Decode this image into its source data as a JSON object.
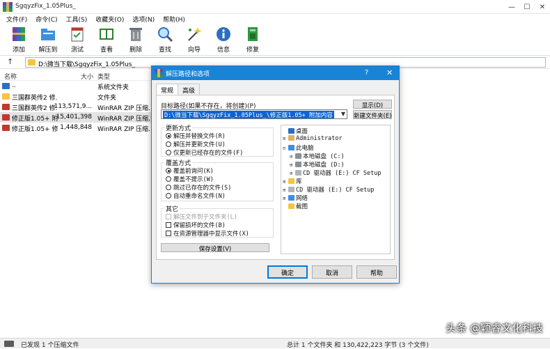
{
  "window": {
    "title": "SgqyzFix_1.05Plus_",
    "controls": [
      "—",
      "☐",
      "✕"
    ]
  },
  "menu": [
    "文件(F)",
    "命令(C)",
    "工具(S)",
    "收藏夹(O)",
    "选项(N)",
    "帮助(H)"
  ],
  "toolbar": [
    {
      "label": "添加",
      "icon": "add-icon"
    },
    {
      "label": "解压到",
      "icon": "extract-to-icon"
    },
    {
      "label": "测试",
      "icon": "test-icon"
    },
    {
      "label": "查看",
      "icon": "view-icon"
    },
    {
      "label": "删除",
      "icon": "delete-icon"
    },
    {
      "label": "查找",
      "icon": "find-icon"
    },
    {
      "label": "向导",
      "icon": "wizard-icon"
    },
    {
      "label": "信息",
      "icon": "info-icon"
    },
    {
      "label": "修复",
      "icon": "repair-icon"
    }
  ],
  "address": {
    "up": "↑",
    "path": "D:\\微当下载\\SgqyzFix_1.05Plus_"
  },
  "filelist": {
    "headers": {
      "name": "名称",
      "size": "大小",
      "type": "类型"
    },
    "rows": [
      {
        "name": "..",
        "size": "",
        "type": "系统文件夹",
        "kind": "up"
      },
      {
        "name": "三国群英传2 修...",
        "size": "",
        "type": "文件夹",
        "kind": "folder"
      },
      {
        "name": "三国群英传2 修...",
        "size": "113,571,9...",
        "type": "WinRAR ZIP 压缩...",
        "kind": "zip"
      },
      {
        "name": "修正版1.05+ 附...",
        "size": "15,401,398",
        "type": "WinRAR ZIP 压缩...",
        "kind": "zip"
      },
      {
        "name": "修正版1.05+ 修...",
        "size": "1,448,848",
        "type": "WinRAR ZIP 压缩...",
        "kind": "zip"
      }
    ]
  },
  "status": {
    "left": "已发现 1 个压缩文件",
    "right": "总计 1 个文件夹 和 130,422,223 字节 (3 个文件)"
  },
  "watermark": "头条 @颖睿文化科技",
  "dialog": {
    "title": "解压路径和选项",
    "help": "?",
    "close": "✕",
    "tabs": [
      "常规",
      "高级"
    ],
    "dest_label": "目标路径(如果不存在，将创建)(P)",
    "dest_value": "D:\\微当下载\\SgqyzFix_1.05Plus_\\修正版1.05+ 附加内容",
    "show_button": "显示(D)",
    "new_folder_button": "新建文件夹(E)",
    "update": {
      "title": "更新方式",
      "options": [
        "解压并替换文件(R)",
        "解压并更新文件(U)",
        "仅更新已经存在的文件(F)"
      ],
      "selected": 0
    },
    "overwrite": {
      "title": "覆盖方式",
      "options": [
        "覆盖前询问(K)",
        "覆盖不提示(W)",
        "跳过已存在的文件(S)",
        "自动重命名文件(N)"
      ],
      "selected": 0
    },
    "misc": {
      "title": "其它",
      "options": [
        {
          "label": "解压文件到子文件夹(L)",
          "disabled": true
        },
        {
          "label": "保留损坏的文件(B)",
          "disabled": false
        },
        {
          "label": "在资源管理器中显示文件(X)",
          "disabled": false
        }
      ]
    },
    "save_settings": "保存设置(V)",
    "tree": [
      {
        "label": "桌面",
        "icon": "desktop-icon",
        "exp": "",
        "indent": 0
      },
      {
        "label": "Administrator",
        "icon": "user-icon",
        "exp": "⊞",
        "indent": 1
      },
      {
        "label": "此电脑",
        "icon": "computer-icon",
        "exp": "⊟",
        "indent": 1
      },
      {
        "label": "本地磁盘 (C:)",
        "icon": "drive-icon",
        "exp": "⊞",
        "indent": 2
      },
      {
        "label": "本地磁盘 (D:)",
        "icon": "drive-icon",
        "exp": "⊞",
        "indent": 2
      },
      {
        "label": "CD 驱动器 (E:) CF Setup",
        "icon": "cd-icon",
        "exp": "⊞",
        "indent": 2
      },
      {
        "label": "库",
        "icon": "library-icon",
        "exp": "⊞",
        "indent": 1
      },
      {
        "label": "CD 驱动器 (E:) CF Setup",
        "icon": "cd-icon",
        "exp": "⊞",
        "indent": 1
      },
      {
        "label": "网络",
        "icon": "network-icon",
        "exp": "⊞",
        "indent": 1
      },
      {
        "label": "截图",
        "icon": "folder-icon",
        "exp": "",
        "indent": 1
      }
    ],
    "buttons": {
      "ok": "确定",
      "cancel": "取消",
      "help": "帮助"
    }
  },
  "colors": {
    "dialog_title_bar": "#1984d6",
    "selection": "#0a64d6",
    "folder": "#f5c542",
    "zip_icon": "#c0392b"
  }
}
